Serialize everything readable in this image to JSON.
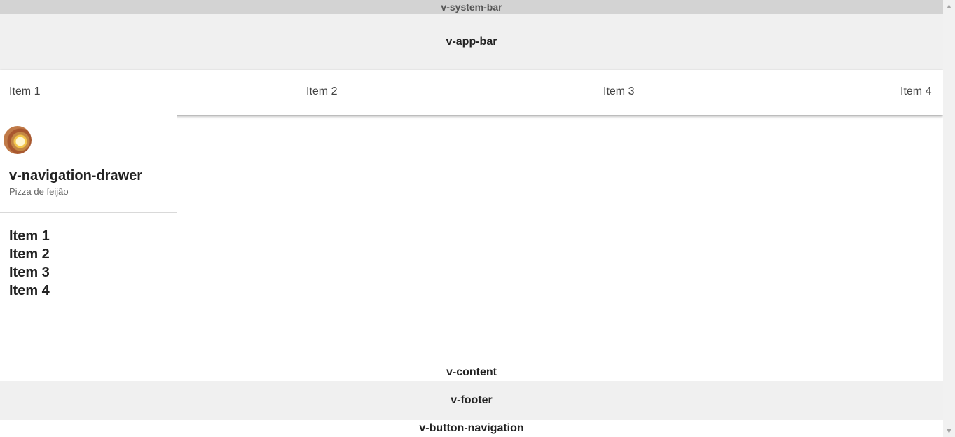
{
  "system_bar": {
    "label": "v-system-bar"
  },
  "app_bar": {
    "label": "v-app-bar"
  },
  "tabs": [
    {
      "label": "Item 1"
    },
    {
      "label": "Item 2"
    },
    {
      "label": "Item 3"
    },
    {
      "label": "Item 4"
    }
  ],
  "drawer": {
    "title": "v-navigation-drawer",
    "subtitle": "Pizza de feijão",
    "items": [
      {
        "label": "Item 1"
      },
      {
        "label": "Item 2"
      },
      {
        "label": "Item 3"
      },
      {
        "label": "Item 4"
      }
    ]
  },
  "content": {
    "label": "v-content"
  },
  "footer": {
    "label": "v-footer"
  },
  "bottom_navigation": {
    "label": "v-button-navigation"
  },
  "scrollbar": {
    "up_icon": "▲",
    "down_icon": "▼"
  }
}
